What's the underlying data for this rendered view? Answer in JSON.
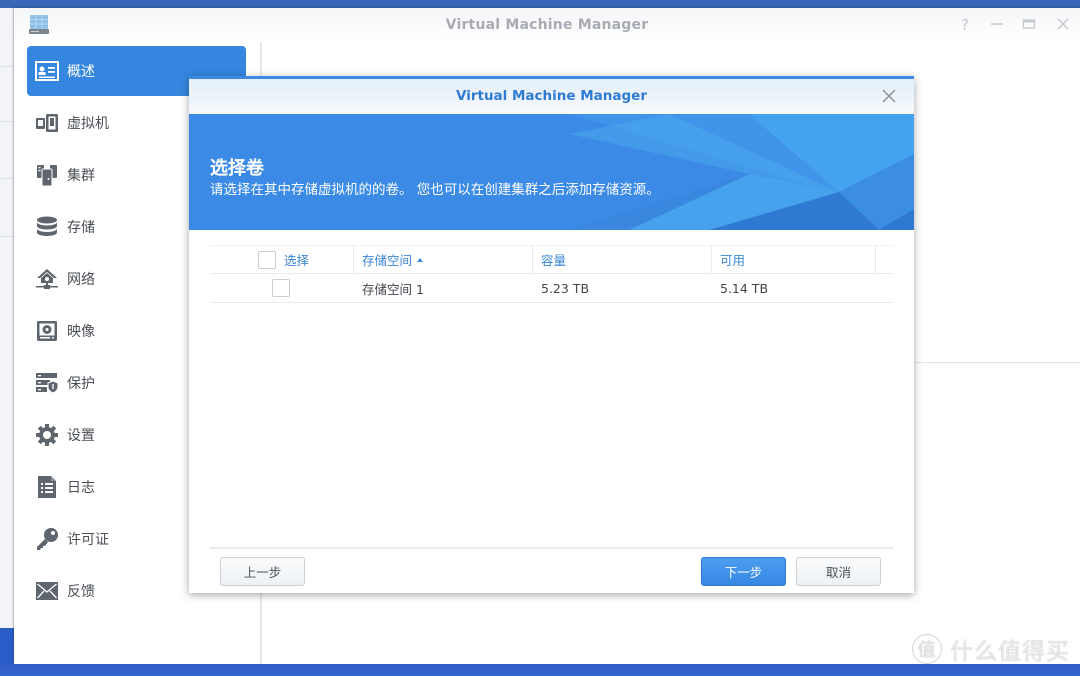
{
  "window": {
    "title": "Virtual Machine Manager",
    "controls": {
      "help": "?",
      "minimize": "—",
      "maximize": "▭",
      "close": "✕"
    }
  },
  "sidebar": {
    "items": [
      {
        "label": "概述",
        "icon": "overview-card-icon",
        "active": true
      },
      {
        "label": "虚拟机",
        "icon": "virtual-machine-icon",
        "active": false
      },
      {
        "label": "集群",
        "icon": "cluster-icon",
        "active": false
      },
      {
        "label": "存储",
        "icon": "storage-database-icon",
        "active": false
      },
      {
        "label": "网络",
        "icon": "network-icon",
        "active": false
      },
      {
        "label": "映像",
        "icon": "image-disk-icon",
        "active": false
      },
      {
        "label": "保护",
        "icon": "protection-shield-icon",
        "active": false
      },
      {
        "label": "设置",
        "icon": "settings-gear-icon",
        "active": false
      },
      {
        "label": "日志",
        "icon": "log-document-icon",
        "active": false
      },
      {
        "label": "许可证",
        "icon": "license-key-icon",
        "active": false
      },
      {
        "label": "反馈",
        "icon": "feedback-mail-icon",
        "active": false
      }
    ]
  },
  "dialog": {
    "title": "Virtual Machine Manager",
    "banner": {
      "title": "选择卷",
      "subtitle": "请选择在其中存储虚拟机的的卷。 您也可以在创建集群之后添加存储资源。"
    },
    "grid": {
      "columns": [
        {
          "label": "选择"
        },
        {
          "label": "存储空间",
          "sorted": "asc"
        },
        {
          "label": "容量"
        },
        {
          "label": "可用"
        }
      ],
      "rows": [
        {
          "selected": false,
          "volume": "存储空间 1",
          "capacity": "5.23 TB",
          "available": "5.14 TB"
        }
      ]
    },
    "buttons": {
      "back": "上一步",
      "next": "下一步",
      "cancel": "取消"
    }
  },
  "watermark": {
    "badge": "值",
    "text": "什么值得买"
  },
  "colors": {
    "accent": "#3586de",
    "dialog_title": "#2f7bd3",
    "banner": "#3a8ae6",
    "header_text": "#3a86d6"
  }
}
